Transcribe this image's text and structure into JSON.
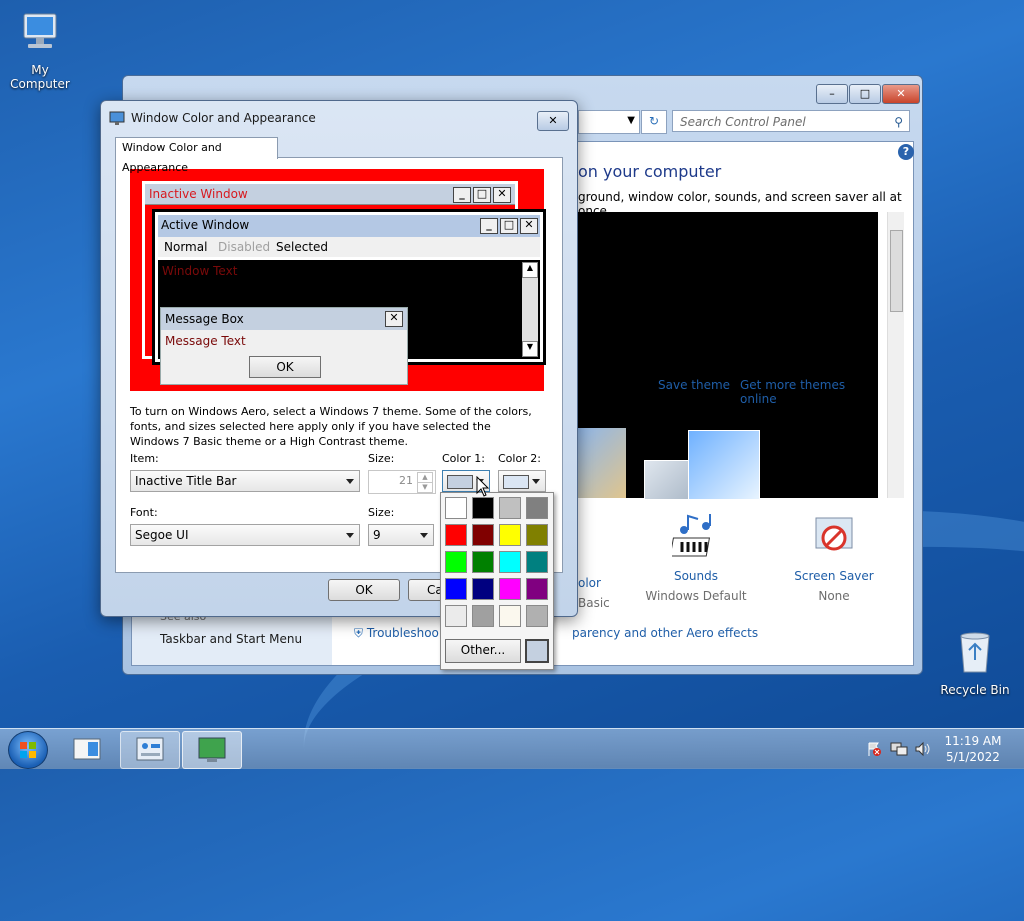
{
  "desktop": {
    "my_computer": "My Computer",
    "recycle_bin": "Recycle Bin"
  },
  "control_panel": {
    "search_placeholder": "Search Control Panel",
    "heading": "on your computer",
    "subheading": "ground, window color, sounds, and screen saver all at once.",
    "save_theme": "Save theme",
    "more_themes": "Get more themes online",
    "bottom_items": [
      {
        "title": "olor",
        "sub": "Basic"
      },
      {
        "title": "Sounds",
        "sub": "Windows Default"
      },
      {
        "title": "Screen Saver",
        "sub": "None"
      }
    ],
    "see_also": "See also",
    "taskbar_link": "Taskbar and Start Menu",
    "troubleshoot": "Troubleshoo",
    "aero_link": "parency and other Aero effects"
  },
  "dialog": {
    "title": "Window Color and Appearance",
    "tab": "Window Color and Appearance",
    "preview": {
      "inactive_window": "Inactive Window",
      "active_window": "Active Window",
      "menu_normal": "Normal",
      "menu_disabled": "Disabled",
      "menu_selected": "Selected",
      "window_text": "Window Text",
      "message_box": "Message Box",
      "message_text": "Message Text",
      "ok": "OK"
    },
    "description": "To turn on Windows Aero, select a Windows 7 theme.  Some of the colors, fonts, and sizes selected here apply only if you have selected the Windows 7 Basic theme or a High Contrast theme.",
    "item_label": "Item:",
    "item_value": "Inactive Title Bar",
    "size_label": "Size:",
    "size_value": "21",
    "color1_label": "Color 1:",
    "color2_label": "Color 2:",
    "font_label": "Font:",
    "font_value": "Segoe UI",
    "font_size_label": "Size:",
    "font_size_value": "9",
    "ok_button": "OK",
    "cancel_button": "Ca"
  },
  "palette": {
    "colors": [
      "#ffffff",
      "#000000",
      "#c0c0c0",
      "#808080",
      "#ff0000",
      "#800000",
      "#ffff00",
      "#808000",
      "#00ff00",
      "#008000",
      "#00ffff",
      "#008080",
      "#0000ff",
      "#000080",
      "#ff00ff",
      "#800080",
      "#ebebeb",
      "#a0a0a0",
      "#fbf8ee",
      "#b0b0b0"
    ],
    "other_button": "Other...",
    "selected_color": "#c4d0e0"
  },
  "taskbar": {
    "time": "11:19 AM",
    "date": "5/1/2022"
  }
}
